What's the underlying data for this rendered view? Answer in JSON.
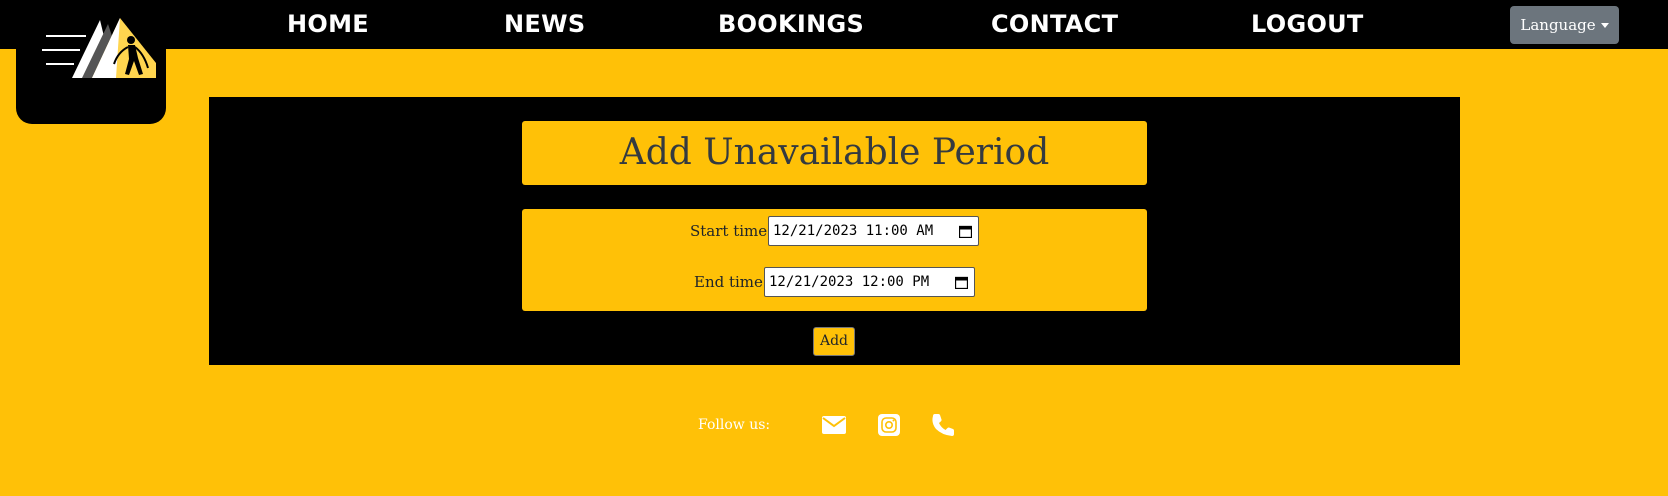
{
  "nav": {
    "items": [
      "HOME",
      "NEWS",
      "BOOKINGS",
      "CONTACT",
      "LOGOUT"
    ],
    "language_label": "Language"
  },
  "form": {
    "title": "Add Unavailable Period",
    "start_label": "Start time:",
    "start_value": "12/21/2023 11:00 AM",
    "end_label": "End time:",
    "end_value": "12/21/2023 12:00 PM",
    "submit_label": "Add"
  },
  "footer": {
    "follow_label": "Follow us:",
    "icons": [
      "envelope-icon",
      "instagram-icon",
      "phone-icon"
    ]
  },
  "colors": {
    "accent": "#FFC107",
    "dark": "#000000",
    "button_gray": "#6c757d",
    "text_dark": "#343a40"
  }
}
